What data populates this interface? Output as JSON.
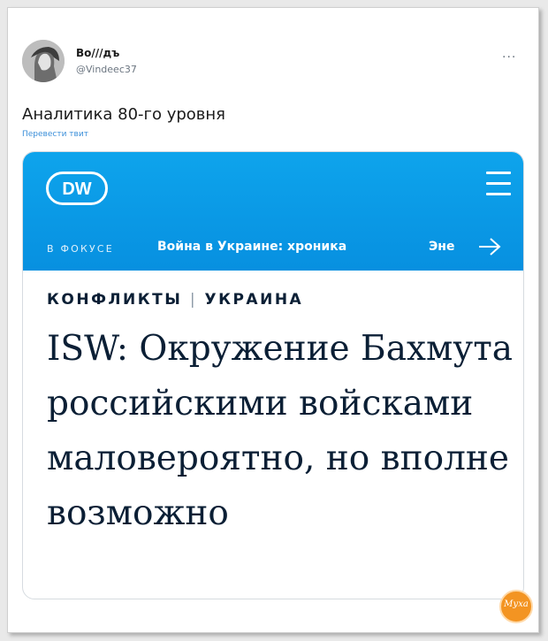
{
  "tweet": {
    "author_name": "Во///дъ",
    "author_handle": "@Vindeec37",
    "more_label": "...",
    "text": "Аналитика 80-го уровня",
    "translate_label": "Перевести твит"
  },
  "article": {
    "brand_logo_text": "DW",
    "focus_label": "В ФОКУСЕ",
    "focus_link": "Война в Украине: хроника",
    "focus_link_2": "Эне",
    "category_1": "КОНФЛИКТЫ",
    "category_sep": "|",
    "category_2": "УКРАИНА",
    "headline": "ISW: Окружение Бахмута российскими войсками маловероятно, но вполне возможно"
  },
  "watermark": {
    "text": "Муха"
  },
  "colors": {
    "header": "#0b97e6",
    "headline": "#0b1f35",
    "link": "#3b8fd9",
    "watermark": "#f39422"
  }
}
